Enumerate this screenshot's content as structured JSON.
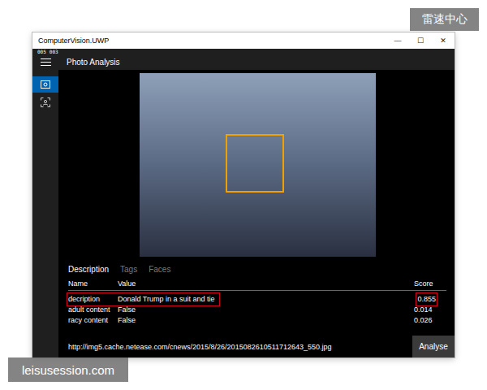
{
  "watermarks": {
    "top": "雷速中心",
    "bottom": "leisusession.com"
  },
  "window": {
    "title": "ComputerVision.UWP",
    "controls": [
      "—",
      "☐",
      "✕"
    ]
  },
  "debug_counters": [
    "005",
    "003"
  ],
  "page_title": "Photo Analysis",
  "sidebar": {
    "items": [
      {
        "selected": true
      },
      {
        "selected": false
      }
    ]
  },
  "tabs": [
    {
      "label": "Description",
      "selected": true
    },
    {
      "label": "Tags",
      "selected": false
    },
    {
      "label": "Faces",
      "selected": false
    }
  ],
  "table": {
    "columns": [
      "Name",
      "Value",
      "Score"
    ],
    "rows": [
      {
        "name": "decription",
        "value": "Donald Trump in a suit and tie",
        "score": "0.855",
        "highlighted": true
      },
      {
        "name": "adult content",
        "value": "False",
        "score": "0.014",
        "highlighted": false
      },
      {
        "name": "racy content",
        "value": "False",
        "score": "0.026",
        "highlighted": false
      }
    ]
  },
  "url_field": {
    "value": "http://img5.cache.netease.com/cnews/2015/8/26/2015082610511712643_550.jpg"
  },
  "analyse_button": {
    "label": "Analyse"
  }
}
